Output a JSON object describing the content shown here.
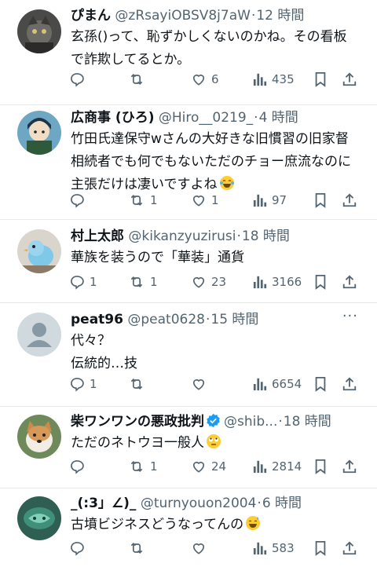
{
  "more_glyph": "···",
  "dot": "·",
  "posts": [
    {
      "name": "ぴまん",
      "handle": "@zRsayiOBSV8j7aW",
      "time": "12 時間",
      "lines": [
        "玄孫()って、恥ずかしくないのかね。その看板",
        "で詐欺してるとか。"
      ],
      "reply": "",
      "repost": "",
      "like": "6",
      "views": "435"
    },
    {
      "name": "広商事 (ひろ)",
      "handle": "@Hiro__0219_",
      "time": "4 時間",
      "lines": [
        "竹田氏達保守wさんの大好きな旧慣習の旧家督",
        "相続者でも何でもないただのチョー庶流なのに",
        "主張だけは凄いですよね"
      ],
      "emoji": "laughing-tears",
      "reply": "",
      "repost": "1",
      "like": "1",
      "views": "97"
    },
    {
      "name": "村上太郎",
      "handle": "@kikanzyuzirusi",
      "time": "18 時間",
      "lines": [
        "華族を装うので「華装」通貨"
      ],
      "reply": "1",
      "repost": "1",
      "like": "23",
      "views": "3166"
    },
    {
      "name": "peat96",
      "handle": "@peat0628",
      "time": "15 時間",
      "lines": [
        "代々？",
        "伝統的…技"
      ],
      "reply": "1",
      "repost": "",
      "like": "",
      "views": "6654"
    },
    {
      "name": "柴ワンワンの悪政批判",
      "handle": "@shib...",
      "time": "18 時間",
      "verified": true,
      "lines": [
        "ただのネトウヨ一般人"
      ],
      "emoji": "rolling-eyes",
      "reply": "",
      "repost": "1",
      "like": "24",
      "views": "2814"
    },
    {
      "name": "_(:3」∠)_",
      "handle": "@turnyouon2004",
      "time": "6 時間",
      "lines": [
        "古墳ビジネスどうなってんの"
      ],
      "emoji": "sweat-smile",
      "reply": "",
      "repost": "",
      "like": "",
      "views": "583"
    }
  ],
  "colors": {
    "text": "#0f1419",
    "secondary": "#536471",
    "divider": "#e6e8ea",
    "verified": "#1d9bf0"
  },
  "icons": [
    "reply-icon",
    "repost-icon",
    "like-icon",
    "views-icon",
    "bookmark-icon",
    "share-icon",
    "verified-badge-icon",
    "more-icon"
  ]
}
